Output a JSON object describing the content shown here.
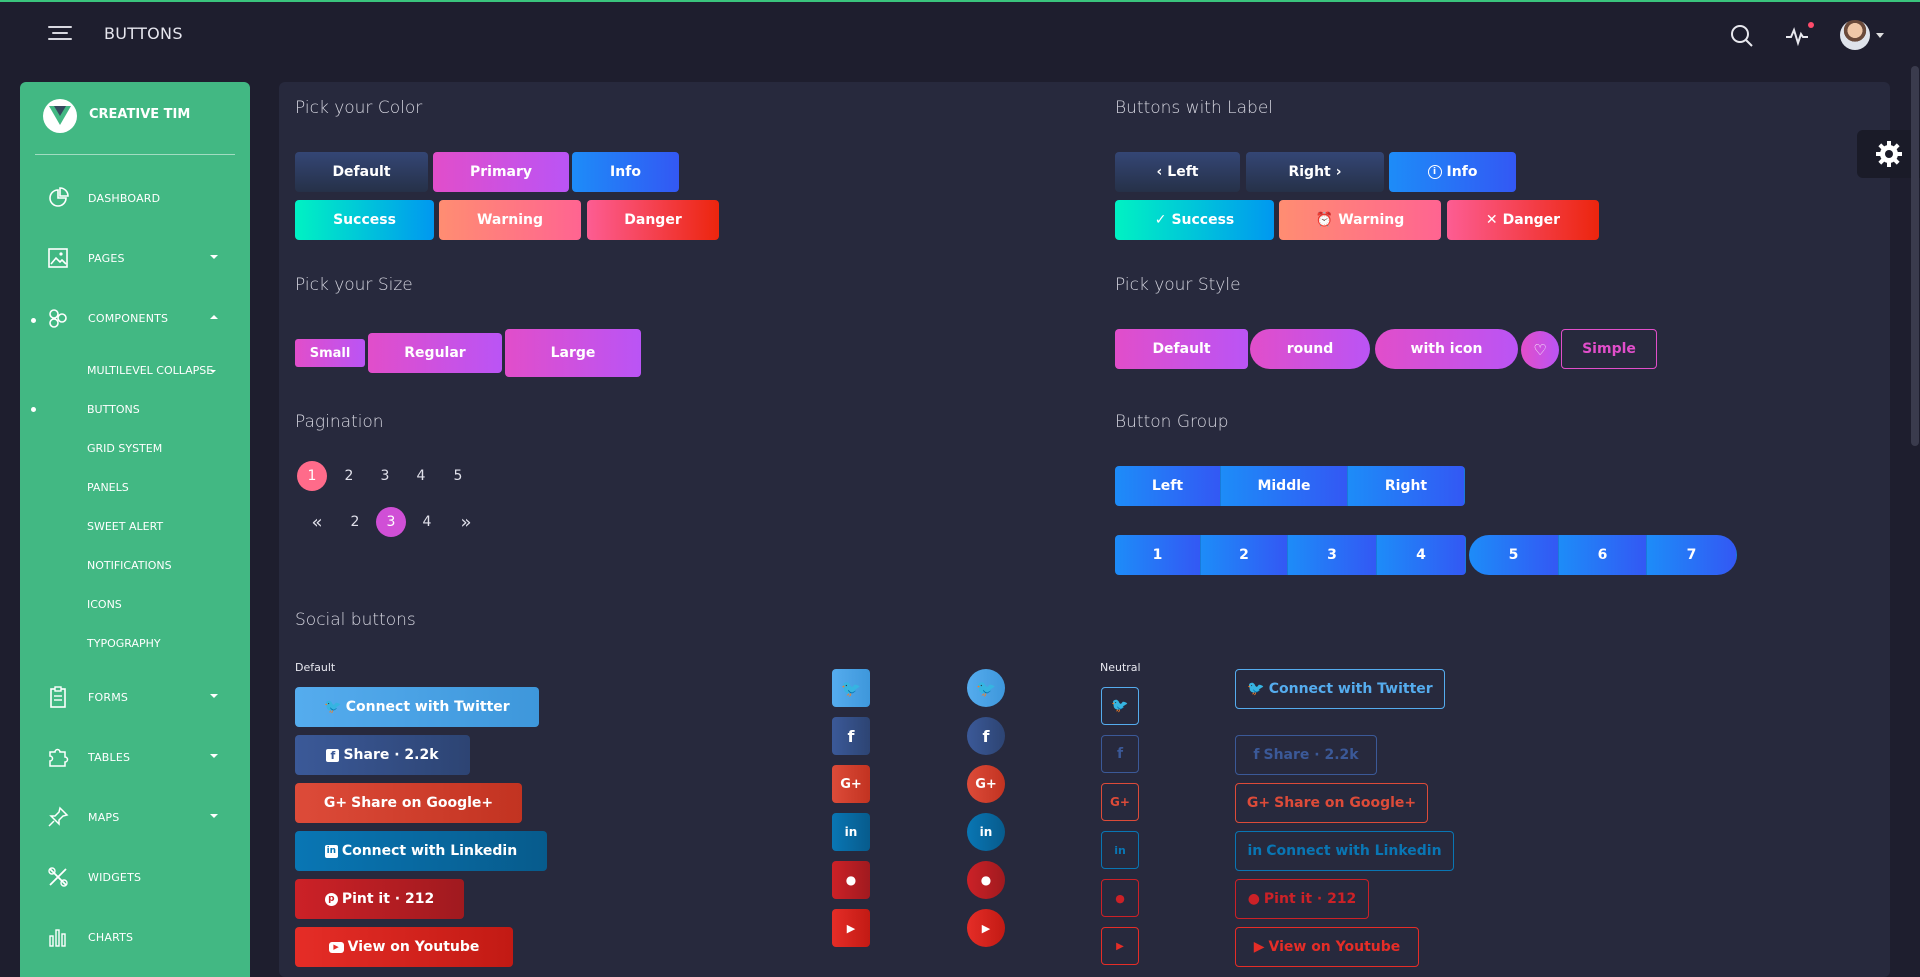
{
  "topbar": {
    "title": "BUTTONS",
    "icons": [
      "menu-icon",
      "search-icon",
      "activity-icon",
      "avatar"
    ]
  },
  "sidebar": {
    "brand": "CREATIVE TIM",
    "items": [
      {
        "label": "DASHBOARD",
        "icon": "dashboard-icon"
      },
      {
        "label": "PAGES",
        "icon": "image-icon"
      },
      {
        "label": "COMPONENTS",
        "icon": "components-icon"
      },
      {
        "label": "FORMS",
        "icon": "clipboard-icon"
      },
      {
        "label": "TABLES",
        "icon": "puzzle-icon"
      },
      {
        "label": "MAPS",
        "icon": "pin-icon"
      },
      {
        "label": "WIDGETS",
        "icon": "tools-icon"
      },
      {
        "label": "CHARTS",
        "icon": "bar-chart-icon"
      }
    ],
    "components_sub": [
      "MULTILEVEL COLLAPSE",
      "BUTTONS",
      "GRID SYSTEM",
      "PANELS",
      "SWEET ALERT",
      "NOTIFICATIONS",
      "ICONS",
      "TYPOGRAPHY"
    ]
  },
  "pick_color": {
    "title": "Pick your Color",
    "buttons": [
      "Default",
      "Primary",
      "Info",
      "Success",
      "Warning",
      "Danger"
    ]
  },
  "buttons_label": {
    "title": "Buttons with Label",
    "buttons": [
      "Left",
      "Right",
      "Info",
      "Success",
      "Warning",
      "Danger"
    ]
  },
  "pick_size": {
    "title": "Pick your Size",
    "buttons": [
      "Small",
      "Regular",
      "Large"
    ]
  },
  "pick_style": {
    "title": "Pick your Style",
    "buttons": [
      "Default",
      "round",
      "with icon",
      "Simple"
    ]
  },
  "pagination": {
    "title": "Pagination",
    "row1": [
      "1",
      "2",
      "3",
      "4",
      "5"
    ],
    "row1_active": "1",
    "row2": [
      "2",
      "3",
      "4"
    ],
    "row2_active": "3"
  },
  "button_group": {
    "title": "Button Group",
    "row1": [
      "Left",
      "Middle",
      "Right"
    ],
    "row2": [
      "1",
      "2",
      "3",
      "4",
      "5",
      "6",
      "7"
    ]
  },
  "social": {
    "title": "Social buttons",
    "default_label": "Default",
    "neutral_label": "Neutral",
    "buttons": [
      {
        "label": "Connect with Twitter",
        "icon": "twitter-icon"
      },
      {
        "label": "Share · 2.2k",
        "icon": "facebook-icon"
      },
      {
        "label": "Share on Google+",
        "icon": "google-plus-icon"
      },
      {
        "label": "Connect with Linkedin",
        "icon": "linkedin-icon"
      },
      {
        "label": "Pint it · 212",
        "icon": "pinterest-icon"
      },
      {
        "label": "View on Youtube",
        "icon": "youtube-icon"
      }
    ],
    "colors": {
      "twitter": "#55acee",
      "facebook": "#3b5998",
      "google": "#dd4b39",
      "linkedin": "#0976b4",
      "pinterest": "#cc2127",
      "youtube": "#e52d27"
    }
  },
  "colors": {
    "sidebar": "#42b883",
    "content_bg": "#27293d",
    "page_bg": "#1e1e2e"
  }
}
